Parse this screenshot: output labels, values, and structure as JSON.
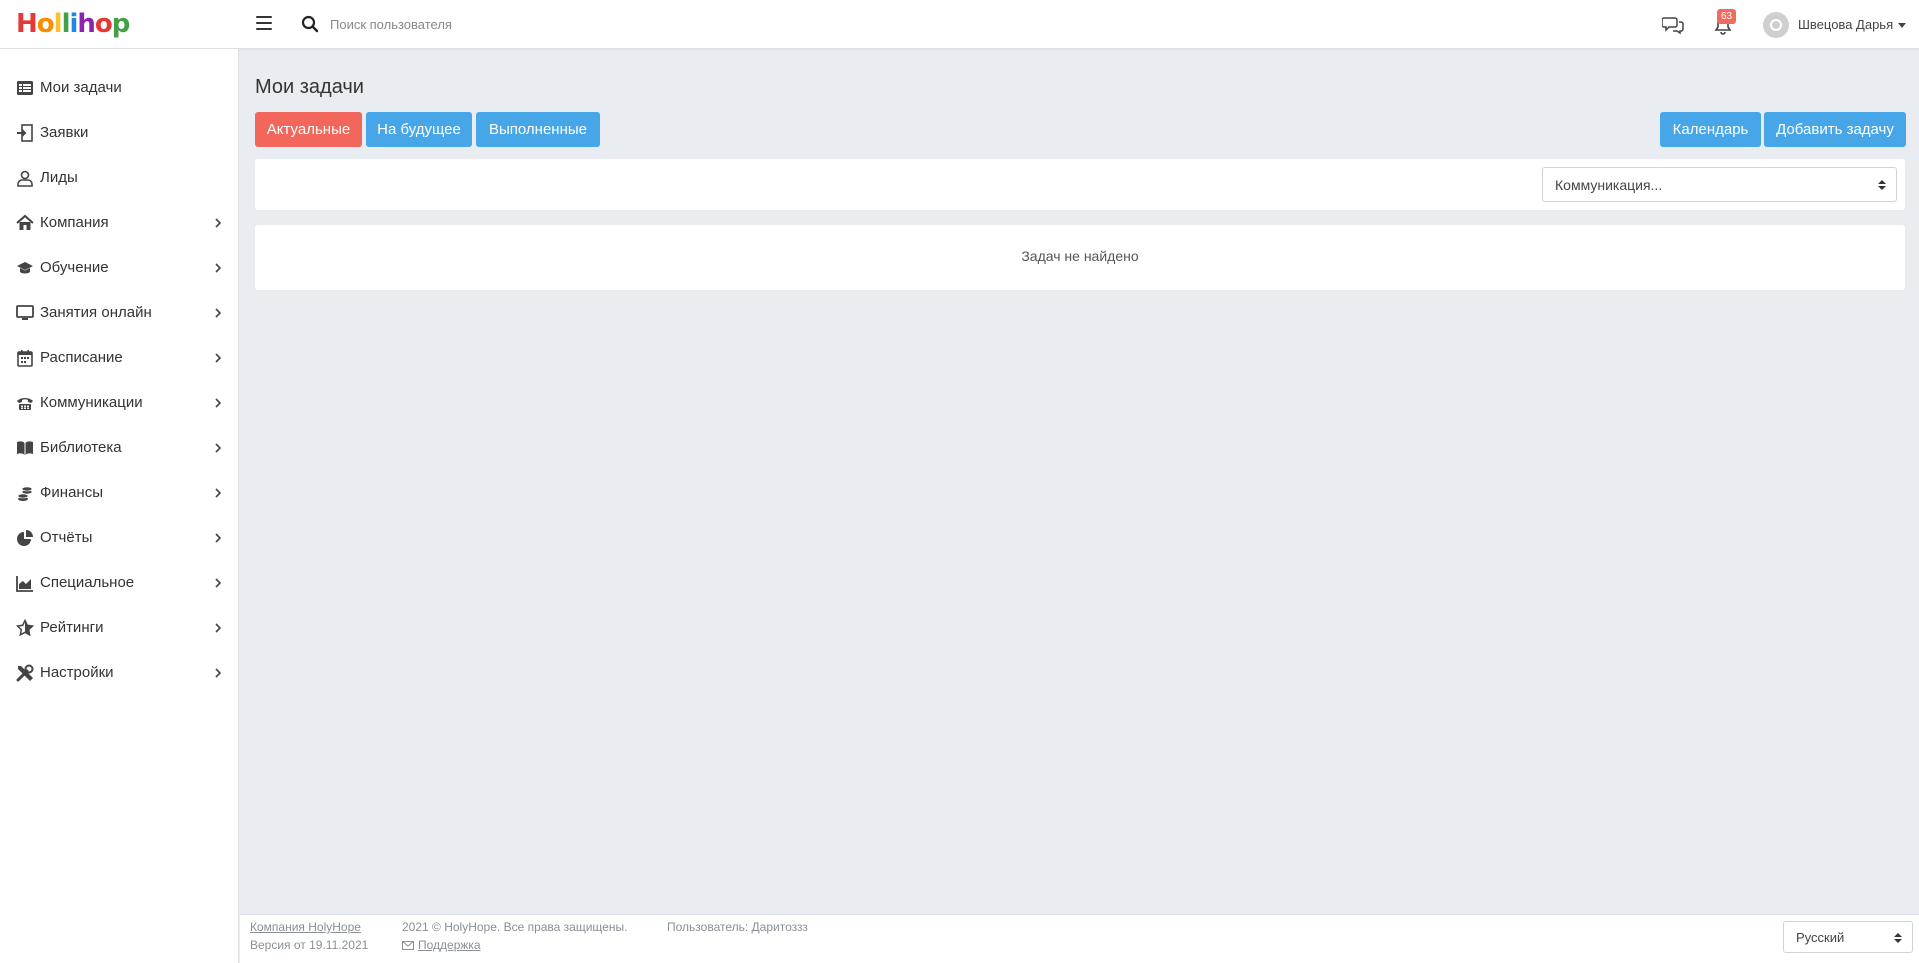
{
  "header": {
    "logo_letters": [
      "H",
      "o",
      "l",
      "l",
      "i",
      "h",
      "o",
      "p"
    ],
    "logo_colors": [
      "#e53935",
      "#fb8c00",
      "#fdd835",
      "#43a047",
      "#1e88e5",
      "#8e24aa",
      "#e53935",
      "#43a047"
    ],
    "search_placeholder": "Поиск пользователя",
    "notifications_count": "63",
    "user_name": "Швецова Дарья"
  },
  "sidebar": {
    "items": [
      {
        "label": "Мои задачи",
        "icon": "list-icon",
        "has_submenu": false
      },
      {
        "label": "Заявки",
        "icon": "sign-in-icon",
        "has_submenu": false
      },
      {
        "label": "Лиды",
        "icon": "user-icon",
        "has_submenu": false
      },
      {
        "label": "Компания",
        "icon": "home-icon",
        "has_submenu": true
      },
      {
        "label": "Обучение",
        "icon": "graduation-cap-icon",
        "has_submenu": true
      },
      {
        "label": "Занятия онлайн",
        "icon": "desktop-icon",
        "has_submenu": true
      },
      {
        "label": "Расписание",
        "icon": "calendar-icon",
        "has_submenu": true
      },
      {
        "label": "Коммуникации",
        "icon": "phone-icon",
        "has_submenu": true
      },
      {
        "label": "Библиотека",
        "icon": "book-icon",
        "has_submenu": true
      },
      {
        "label": "Финансы",
        "icon": "coins-icon",
        "has_submenu": true
      },
      {
        "label": "Отчёты",
        "icon": "pie-chart-icon",
        "has_submenu": true
      },
      {
        "label": "Специальное",
        "icon": "area-chart-icon",
        "has_submenu": true
      },
      {
        "label": "Рейтинги",
        "icon": "star-icon",
        "has_submenu": true
      },
      {
        "label": "Настройки",
        "icon": "tools-icon",
        "has_submenu": true
      }
    ]
  },
  "main": {
    "title": "Мои задачи",
    "tabs": [
      {
        "label": "Актуальные",
        "active": true
      },
      {
        "label": "На будущее",
        "active": false
      },
      {
        "label": "Выполненные",
        "active": false
      }
    ],
    "calendar_label": "Календарь",
    "add_task_label": "Добавить задачу",
    "filter_select_value": "Коммуникация...",
    "empty_message": "Задач не найдено"
  },
  "footer": {
    "company_link": "Компания HolyHope",
    "version": "Версия от 19.11.2021",
    "copyright": "2021 © HolyHope. Все права защищены.",
    "support_link": "Поддержка",
    "user_info": "Пользователь: Даритоззз",
    "language": "Русский"
  },
  "colors": {
    "accent_red": "#f2665c",
    "accent_blue": "#46a6e8",
    "background": "#e9edf2"
  }
}
